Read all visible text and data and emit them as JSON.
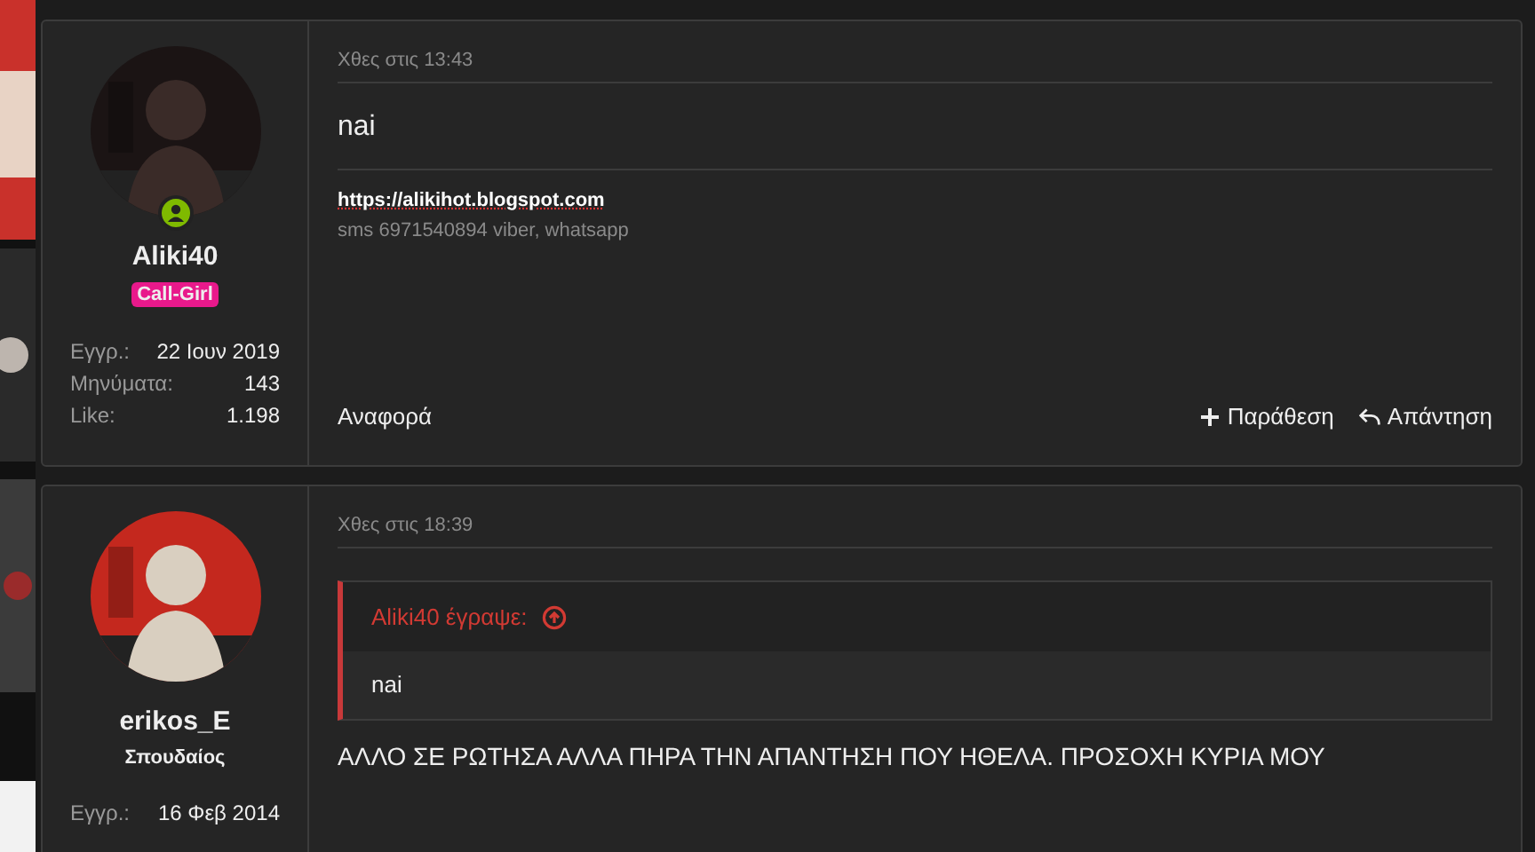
{
  "posts": [
    {
      "online": true,
      "username": "Aliki40",
      "user_title": {
        "kind": "badge",
        "text": "Call-Girl"
      },
      "stats": [
        {
          "label": "Εγγρ.:",
          "value": "22 Ιουν 2019"
        },
        {
          "label": "Μηνύματα:",
          "value": "143"
        },
        {
          "label": "Like:",
          "value": "1.198"
        }
      ],
      "date": "Χθες στις 13:43",
      "body": "nai",
      "signature": {
        "link": "https://alikihot.blogspot.com",
        "text": "sms 6971540894 viber, whatsapp"
      },
      "actions": {
        "report": "Αναφορά",
        "quote": "Παράθεση",
        "reply": "Απάντηση"
      }
    },
    {
      "online": false,
      "username": "erikos_E",
      "user_title": {
        "kind": "text",
        "text": "Σπουδαίος"
      },
      "stats": [
        {
          "label": "Εγγρ.:",
          "value": "16 Φεβ 2014"
        }
      ],
      "date": "Χθες στις 18:39",
      "quote": {
        "author": "Aliki40 έγραψε:",
        "text": "nai"
      },
      "body": "ΑΛΛΟ ΣΕ ΡΩΤΗΣΑ ΑΛΛΑ ΠΗΡΑ ΤΗΝ ΑΠΑΝΤΗΣΗ ΠΟΥ ΗΘΕΛΑ. ΠΡΟΣΟΧΗ ΚΥΡΙΑ ΜΟΥ"
    }
  ]
}
